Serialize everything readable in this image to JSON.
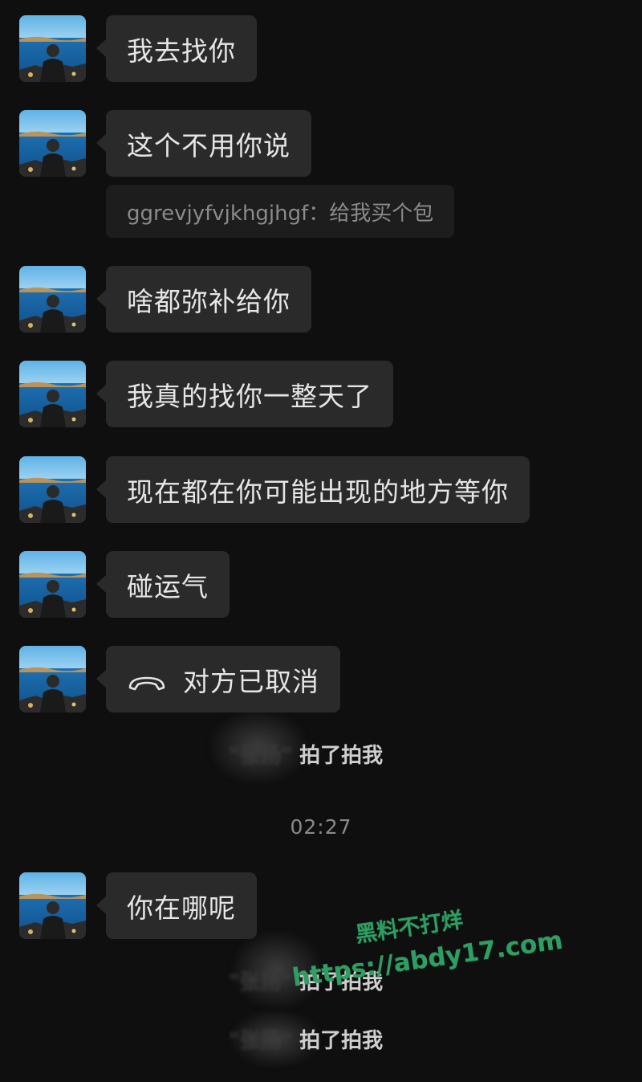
{
  "messages": [
    {
      "text": "我去找你"
    },
    {
      "text": "这个不用你说"
    },
    {
      "text": "啥都弥补给你"
    },
    {
      "text": "我真的找你一整天了"
    },
    {
      "text": "现在都在你可能出现的地方等你"
    },
    {
      "text": "碰运气"
    },
    {
      "text": "对方已取消",
      "icon": "phone-hangup-icon"
    },
    {
      "text": "你在哪呢"
    }
  ],
  "quote": {
    "text": "ggrevjyfvjkhgjhgf：给我买个包"
  },
  "system_notices": [
    {
      "name": "\"张​​扬\"",
      "text": "拍了拍我"
    },
    {
      "name": "\"张​​扬\"",
      "text": "拍了拍我"
    },
    {
      "name": "\"张​​扬\"",
      "text": "拍了拍我"
    }
  ],
  "timestamp": "02:27",
  "watermark": {
    "line1": "黑料不打烊",
    "line2": "https://abdy17.com"
  },
  "colors": {
    "background": "#0f0f0f",
    "bubble": "#2a2a2a",
    "quote_bg": "#1d1d1d",
    "watermark": "#2f9e63"
  }
}
